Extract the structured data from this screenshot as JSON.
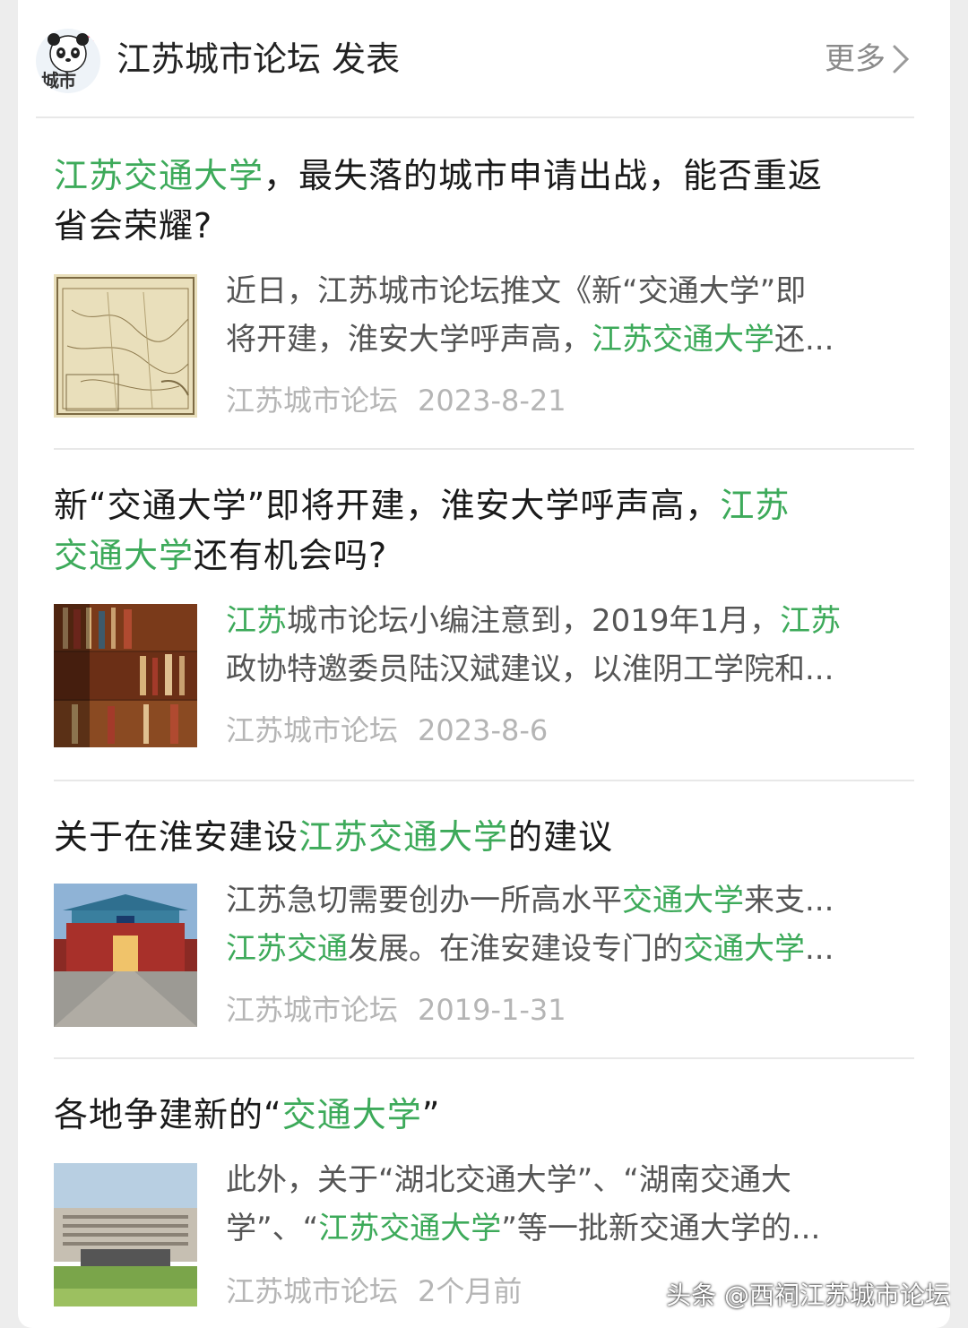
{
  "header": {
    "avatar_text": "城市",
    "account_name": "江苏城市论坛 发表",
    "more_label": "更多"
  },
  "colors": {
    "highlight": "#3daa5a",
    "meta": "#b5b5b5",
    "summary": "#555555"
  },
  "articles": [
    {
      "title_parts": [
        "江苏交通大学",
        "，最失落的城市申请出战，能否重返",
        "省会荣耀?"
      ],
      "summary_line1": [
        "近日，江苏城市论坛推文《新“交通大学”即"
      ],
      "summary_line2": [
        "将开建，淮安大学呼声高，",
        "江苏交通大学",
        "还..."
      ],
      "source": "江苏城市论坛",
      "date": "2023-8-21",
      "thumb": "map-thumbnail"
    },
    {
      "title_parts": [
        "新“交通大学”即将开建，淮安大学呼声高，",
        "江苏",
        "交通大学",
        "还有机会吗?"
      ],
      "summary_line1": [
        "江苏",
        "城市论坛小编注意到，2019年1月，",
        "江苏"
      ],
      "summary_line2": [
        "政协特邀委员陆汉斌建议，以淮阴工学院和..."
      ],
      "source": "江苏城市论坛",
      "date": "2023-8-6",
      "thumb": "bookshelf-thumbnail"
    },
    {
      "title_parts": [
        "关于在淮安建设",
        "江苏交通大学",
        "的建议"
      ],
      "summary_line1": [
        "江苏急切需要创办一所高水平",
        "交通大学",
        "来支..."
      ],
      "summary_line2": [
        "江苏交通",
        "发展。在淮安建设专门的",
        "交通大学",
        "..."
      ],
      "source": "江苏城市论坛",
      "date": "2019-1-31",
      "thumb": "gate-thumbnail"
    },
    {
      "title_parts": [
        "各地争建新的“",
        "交通大学",
        "”"
      ],
      "summary_line1": [
        "此外，关于“湖北交通大学”、“湖南交通大"
      ],
      "summary_line2": [
        "学”、“",
        "江苏交通大学",
        "”等一批新交通大学的..."
      ],
      "source": "江苏城市论坛",
      "date": "2个月前",
      "thumb": "campus-thumbnail"
    }
  ],
  "watermark": "头条 @西祠江苏城市论坛"
}
